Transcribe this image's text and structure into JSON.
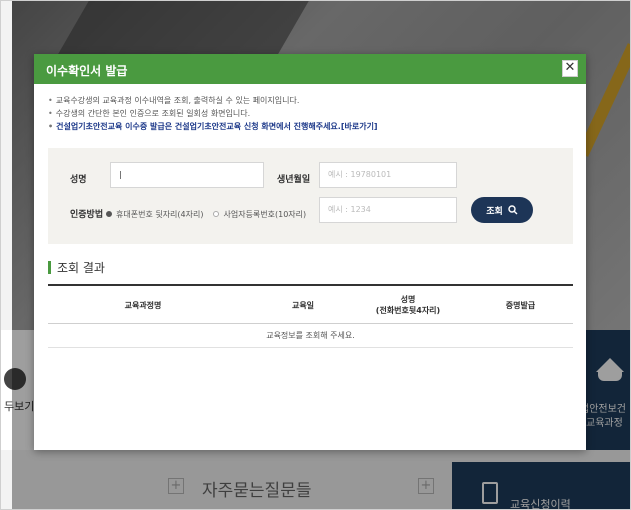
{
  "background": {
    "left_side_text": "두보기",
    "right_card": {
      "line1": "업안전보건",
      "line2": "교육과정"
    },
    "faq_title": "자주묻는질문들",
    "bottom_card_text": "교육신청이력"
  },
  "modal": {
    "title": "이수확인서 발급",
    "close_icon": "close-icon",
    "notices": [
      "교육수강생의 교육과정 이수내역을 조회, 출력하실 수 있는 페이지입니다.",
      "수강생의 간단한 본인 인증으로 조회된 일회성 화면입니다.",
      "건설업기초안전교육 이수증 발급은 건설업기초안전교육 신청 화면에서 진행해주세요.[바로가기]"
    ],
    "form": {
      "name_label": "성명",
      "name_value": "|",
      "birth_label": "생년월일",
      "birth_placeholder": "예시 : 19780101",
      "auth_label": "인증방법",
      "auth_options": [
        {
          "label": "휴대폰번호 뒷자리(4자리)",
          "selected": true
        },
        {
          "label": "사업자등록번호(10자리)",
          "selected": false
        }
      ],
      "auth_placeholder": "예시 : 1234",
      "search_button": "조회",
      "search_icon": "search-icon"
    },
    "results": {
      "title": "조회 결과",
      "columns": [
        {
          "line1": "교육과정명",
          "line2": ""
        },
        {
          "line1": "교육일",
          "line2": ""
        },
        {
          "line1": "성명",
          "line2": "(전화번호뒷4자리)"
        },
        {
          "line1": "증명발급",
          "line2": ""
        }
      ],
      "empty_message": "교육정보를 조회해 주세요."
    }
  },
  "colors": {
    "header_green": "#4a9a40",
    "navy_button": "#1d3557",
    "notice_blue": "#1e3a8a",
    "panel_bg": "#f3f2ee"
  }
}
